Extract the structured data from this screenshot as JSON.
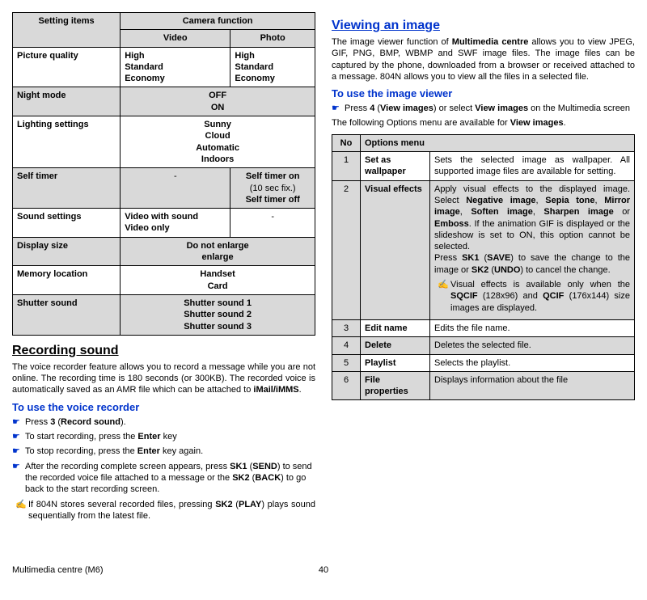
{
  "left": {
    "table1": {
      "th_setting": "Setting items",
      "th_camera": "Camera function",
      "th_video": "Video",
      "th_photo": "Photo",
      "r1_label": "Picture quality",
      "r1_video": "High\nStandard\nEconomy",
      "r1_photo": "High\nStandard\nEconomy",
      "r2_label": "Night mode",
      "r2_val": "OFF\nON",
      "r3_label": "Lighting settings",
      "r3_val": "Sunny\nCloud\nAutomatic\nIndoors",
      "r4_label": "Self timer",
      "r4_video": "-",
      "r4_photo_l1": "Self timer on",
      "r4_photo_l2": "(10 sec fix.)",
      "r4_photo_l3": "Self timer off",
      "r5_label": "Sound settings",
      "r5_video": "Video with sound\nVideo only",
      "r5_photo": "-",
      "r6_label": "Display size",
      "r6_val": "Do not enlarge\nenlarge",
      "r7_label": "Memory location",
      "r7_val": "Handset\nCard",
      "r8_label": "Shutter sound",
      "r8_val": "Shutter sound 1\nShutter sound 2\nShutter sound 3"
    },
    "h1_recording": "Recording sound",
    "recording_p1_a": "The voice recorder feature allows you to record a message while you are not online. The recording time is 180 seconds (or 300KB). The recorded voice is automatically saved as an AMR file which can be attached to ",
    "recording_p1_b": "iMail/iMMS",
    "recording_p1_c": ".",
    "h2_voice": "To use the voice recorder",
    "li1_a": "Press ",
    "li1_b": "3",
    "li1_c": " (",
    "li1_d": "Record sound",
    "li1_e": ").",
    "li2_a": "To start recording, press the ",
    "li2_b": "Enter",
    "li2_c": " key",
    "li3_a": "To stop recording, press the ",
    "li3_b": "Enter",
    "li3_c": " key again.",
    "li4_a": "After the recording complete screen appears, press ",
    "li4_b": "SK1",
    "li4_c": " (",
    "li4_d": "SEND",
    "li4_e": ") to send the recorded voice file attached to a message or the ",
    "li4_f": "SK2",
    "li4_g": " (",
    "li4_h": "BACK",
    "li4_i": ") to go back to the start recording screen.",
    "note1_a": "If 804N stores several recorded files, pressing ",
    "note1_b": "SK2",
    "note1_c": " (",
    "note1_d": "PLAY",
    "note1_e": ") plays sound sequentially from the latest file."
  },
  "right": {
    "h1_viewing": "Viewing an image",
    "viewing_p1_a": "The image viewer function of ",
    "viewing_p1_b": "Multimedia centre",
    "viewing_p1_c": " allows you to view JPEG, GIF, PNG, BMP, WBMP and SWF image files. The image files can be captured by the phone, downloaded from a browser or received attached to a message. 804N allows you to view all the files in a selected file.",
    "h2_viewer": "To use the image viewer",
    "li_v1_a": "Press ",
    "li_v1_b": "4",
    "li_v1_c": " (",
    "li_v1_d": "View images",
    "li_v1_e": ") or select ",
    "li_v1_f": "View images",
    "li_v1_g": " on the Multimedia screen",
    "options_intro_a": "The following Options menu are available for ",
    "options_intro_b": "View images",
    "options_intro_c": ".",
    "table2": {
      "th_no": "No",
      "th_menu": "Options menu",
      "r1_no": "1",
      "r1_name": "Set as wallpaper",
      "r1_desc": "Sets the selected image as wallpaper. All supported image files are available for setting.",
      "r2_no": "2",
      "r2_name": "Visual effects",
      "r2_desc_a": "Apply visual effects to the displayed image. Select ",
      "r2_desc_b": "Negative image",
      "r2_desc_c": ", ",
      "r2_desc_d": "Sepia tone",
      "r2_desc_e": ", ",
      "r2_desc_f": "Mirror image",
      "r2_desc_g": ", ",
      "r2_desc_h": "Soften image",
      "r2_desc_i": ", ",
      "r2_desc_j": "Sharpen image",
      "r2_desc_k": " or ",
      "r2_desc_l": "Emboss",
      "r2_desc_m": ". If the animation GIF is displayed or the slideshow is set to ON, this option cannot be selected.",
      "r2_desc_n": "Press ",
      "r2_desc_o": "SK1",
      "r2_desc_p": " (",
      "r2_desc_q": "SAVE",
      "r2_desc_r": ") to save the change to the image or ",
      "r2_desc_s": "SK2",
      "r2_desc_t": " (",
      "r2_desc_u": "UNDO",
      "r2_desc_v": ") to cancel the change.",
      "r2_note_a": "Visual effects is available only when the ",
      "r2_note_b": "SQCIF",
      "r2_note_c": " (128x96) and ",
      "r2_note_d": "QCIF",
      "r2_note_e": " (176x144) size images are displayed.",
      "r3_no": "3",
      "r3_name": "Edit name",
      "r3_desc": "Edits the file name.",
      "r4_no": "4",
      "r4_name": "Delete",
      "r4_desc": "Deletes the selected file.",
      "r5_no": "5",
      "r5_name": "Playlist",
      "r5_desc": "Selects the playlist.",
      "r6_no": "6",
      "r6_name": "File properties",
      "r6_desc": "Displays information about the file"
    }
  },
  "footer": {
    "left": "Multimedia centre (M6)",
    "page": "40"
  }
}
